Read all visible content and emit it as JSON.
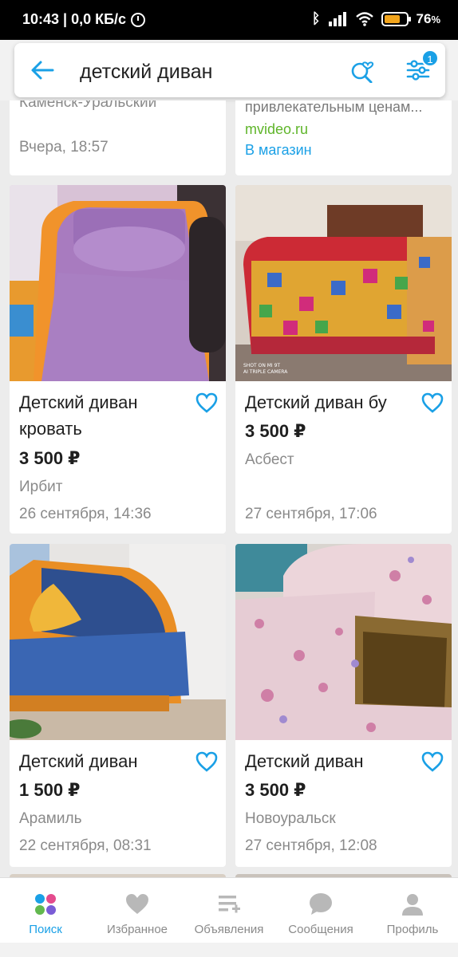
{
  "status_bar": {
    "time_speed": "10:43 | 0,0 КБ/с",
    "battery": "76",
    "battery_pct_sign": "%",
    "battery_level": 0.76
  },
  "search": {
    "query": "детский диван",
    "filter_count": "1"
  },
  "icons": {
    "back": "arrow-left-icon",
    "saved_search": "search-heart-icon",
    "filter": "sliders-icon",
    "favorite": "heart-outline-icon"
  },
  "colors": {
    "accent": "#1aa0e6",
    "price": "#1f1f1f",
    "meta": "#8a8a8a",
    "link_green": "#5fb52a"
  },
  "partial_cards": [
    {
      "city": "Каменск-Уральский",
      "date": "Вчера, 18:57"
    },
    {
      "description": "привлекательным ценам...",
      "domain": "mvideo.ru",
      "cta": "В магазин"
    }
  ],
  "listings": [
    {
      "title": "Детский диван кровать",
      "price": "3 500 ₽",
      "city": "Ирбит",
      "date": "26 сентября, 14:36"
    },
    {
      "title": "Детский диван бу",
      "price": "3 500 ₽",
      "city": "Асбест",
      "date": "27 сентября, 17:06"
    },
    {
      "title": "Детский диван",
      "price": "1 500 ₽",
      "city": "Арамиль",
      "date": "22 сентября, 08:31"
    },
    {
      "title": "Детский диван",
      "price": "3 500 ₽",
      "city": "Новоуральск",
      "date": "27 сентября, 12:08"
    }
  ],
  "photo_watermark": "SHOT ON MI 9T\nAI TRIPLE CAMERA",
  "bottom_nav": [
    {
      "label": "Поиск",
      "icon": "search-dots-icon",
      "active": true
    },
    {
      "label": "Избранное",
      "icon": "heart-icon",
      "active": false
    },
    {
      "label": "Объявления",
      "icon": "add-listing-icon",
      "active": false
    },
    {
      "label": "Сообщения",
      "icon": "chat-bubble-icon",
      "active": false
    },
    {
      "label": "Профиль",
      "icon": "profile-icon",
      "active": false
    }
  ]
}
